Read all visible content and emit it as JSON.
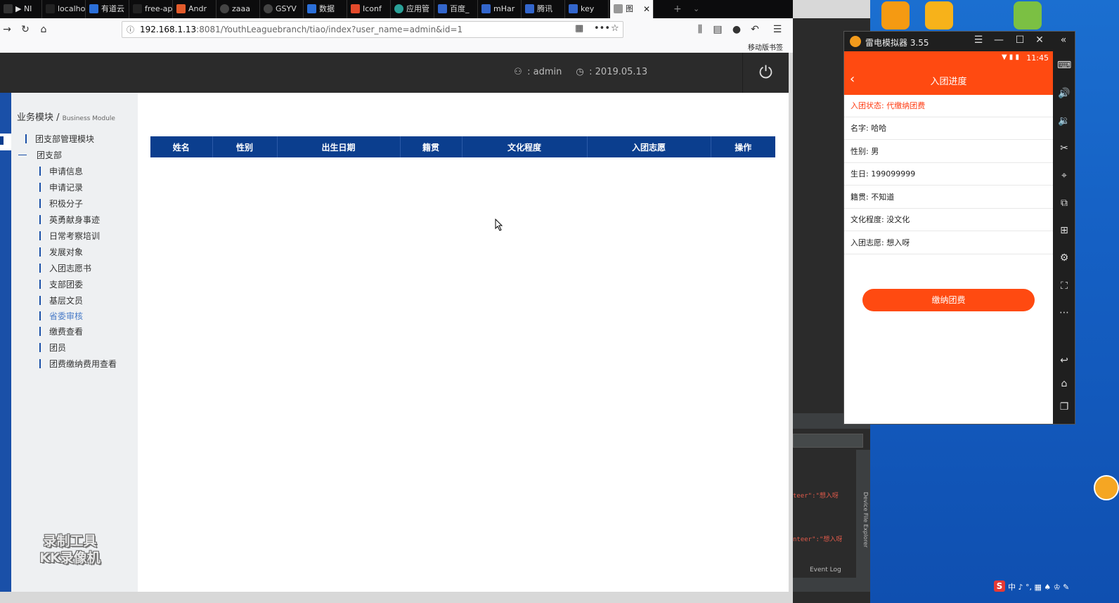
{
  "browser": {
    "tabs": [
      {
        "label": "▶ NI"
      },
      {
        "label": "localhost"
      },
      {
        "label": "有道云"
      },
      {
        "label": "free-api.h"
      },
      {
        "label": "Andr"
      },
      {
        "label": "zaaa"
      },
      {
        "label": "GSYV"
      },
      {
        "label": "数据"
      },
      {
        "label": "Iconf"
      },
      {
        "label": "应用管"
      },
      {
        "label": "百度_"
      },
      {
        "label": "mHar"
      },
      {
        "label": "腾讯"
      },
      {
        "label": "key"
      },
      {
        "label": "图"
      }
    ],
    "new_tab_label": "+",
    "url_host": "192.168.1.13",
    "url_rest": ":8081/YouthLeaguebranch/tiao/index?user_name=admin&id=1",
    "bookmark_mobile": "移动版书签"
  },
  "header": {
    "user_label": ":  admin",
    "date_label": ":  2019.05.13"
  },
  "sidebar": {
    "title": "业务模块 /",
    "title_sub": "Business Module",
    "top_items": [
      {
        "label": "团支部管理模块"
      },
      {
        "label": "团支部"
      }
    ],
    "items": [
      {
        "label": "申请信息"
      },
      {
        "label": "申请记录"
      },
      {
        "label": "积极分子"
      },
      {
        "label": "英勇献身事迹"
      },
      {
        "label": "日常考察培训"
      },
      {
        "label": "发展对象"
      },
      {
        "label": "入团志愿书"
      },
      {
        "label": "支部团委"
      },
      {
        "label": "基层文员"
      },
      {
        "label": "省委审核"
      },
      {
        "label": "缴费查看"
      },
      {
        "label": "团员"
      },
      {
        "label": "团费缴纳费用查看"
      }
    ]
  },
  "table": {
    "headers": [
      "姓名",
      "性别",
      "出生日期",
      "籍贯",
      "文化程度",
      "入团志愿",
      "操作"
    ]
  },
  "watermark": {
    "line1": "录制工具",
    "line2": "KK录像机"
  },
  "ide": {
    "line1": "teer\":\"想入呀",
    "line2": "nteer\":\"想入呀",
    "tool_window": "Device File Explorer",
    "event_log": "Event Log"
  },
  "emulator": {
    "title": "雷电模拟器 3.55",
    "time": "11:45",
    "app_title": "入团进度",
    "rows": [
      {
        "text": "入团状态: 代缴纳团费"
      },
      {
        "text": "名字: 哈哈"
      },
      {
        "text": "性别: 男"
      },
      {
        "text": "生日: 199099999"
      },
      {
        "text": "籍贯: 不知道"
      },
      {
        "text": "文化程度: 没文化"
      },
      {
        "text": "入团志愿: 想入呀"
      }
    ],
    "pay_button": "缴纳团费"
  },
  "tray": {
    "text": "中 ♪ °, ▦ ♠ ♔ ✎"
  },
  "colors": {
    "accent_blue": "#0b3e8e",
    "emulator_orange": "#ff4a11",
    "header_dark": "#2b2b2b"
  }
}
